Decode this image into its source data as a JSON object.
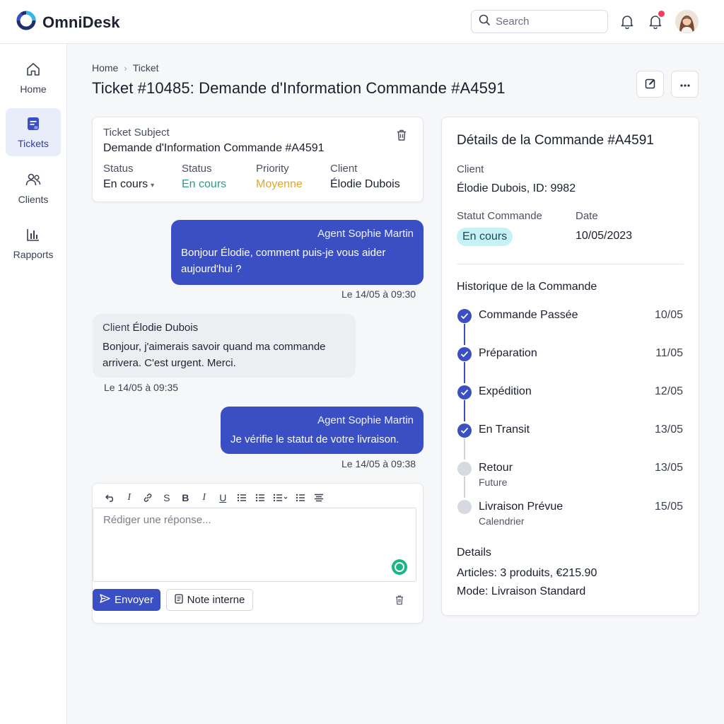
{
  "app": {
    "name": "OmniDesk"
  },
  "search": {
    "placeholder": "Search"
  },
  "colors": {
    "accent": "#3b4fc4",
    "success": "#2f9a83",
    "warning": "#e2a62c",
    "notification": "#ef3f5a",
    "status_pill": "#c6f2f6"
  },
  "sidebar": {
    "items": [
      {
        "label": "Home",
        "icon": "home-icon"
      },
      {
        "label": "Tickets",
        "icon": "tickets-icon",
        "active": true
      },
      {
        "label": "Clients",
        "icon": "users-icon"
      },
      {
        "label": "Rapports",
        "icon": "chart-icon"
      }
    ]
  },
  "breadcrumb": {
    "home": "Home",
    "current": "Ticket"
  },
  "page": {
    "title": "Ticket #10485: Demande d'Information Commande #A4591"
  },
  "ticket": {
    "subject_label": "Ticket Subject",
    "subject": "Demande d'Information Commande #A4591",
    "meta": [
      {
        "label": "Status",
        "value": "En cours"
      },
      {
        "label": "Status",
        "value": "En cours"
      },
      {
        "label": "Priority",
        "value": "Moyenne"
      },
      {
        "label": "Client",
        "value": "Élodie Dubois"
      }
    ]
  },
  "messages": [
    {
      "author": "Agent Sophie Martin",
      "text": "Bonjour Élodie, comment puis-je vous aider aujourd'hui ?",
      "time": "Le 14/05 à 09:30",
      "from": "agent"
    },
    {
      "author_prefix": "Client",
      "author": "Élodie Dubois",
      "text": "Bonjour, j'aimerais savoir quand ma commande arrivera. C'est urgent. Merci.",
      "time": "Le 14/05 à 09:35",
      "from": "client"
    },
    {
      "author": "Agent Sophie Martin",
      "text": "Je vérifie le statut de votre livraison.",
      "time": "Le 14/05 à 09:38",
      "from": "agent"
    }
  ],
  "composer": {
    "placeholder": "Rédiger une réponse...",
    "toolbar": [
      "undo-icon",
      "italic-icon",
      "link-icon",
      "strikethrough-icon",
      "bold-icon",
      "italic-icon",
      "underline-icon",
      "bullet-list-icon",
      "numbered-list-icon",
      "list-dropdown-icon",
      "indent-icon",
      "align-icon"
    ],
    "toolbar_glyphs": {
      "s": "S",
      "b": "B",
      "i": "I",
      "u": "U"
    },
    "send_label": "Envoyer",
    "note_label": "Note interne"
  },
  "order": {
    "title": "Détails de la Commande #A4591",
    "client_label": "Client",
    "client_value": "Élodie Dubois, ID: 9982",
    "status_label": "Statut Commande",
    "status_value": "En cours",
    "date_label": "Date",
    "date_value": "10/05/2023",
    "history_title": "Historique de la Commande",
    "history": [
      {
        "label": "Commande Passée",
        "date": "10/05",
        "done": true
      },
      {
        "label": "Préparation",
        "date": "11/05",
        "done": true
      },
      {
        "label": "Expédition",
        "date": "12/05",
        "done": true
      },
      {
        "label": "En Transit",
        "date": "13/05",
        "done": true
      },
      {
        "label": "Retour",
        "sub": "Future",
        "date": "13/05",
        "done": false
      },
      {
        "label": "Livraison Prévue",
        "sub": "Calendrier",
        "date": "15/05",
        "done": false
      }
    ],
    "details_title": "Details",
    "articles": "Articles: 3 produits, €215.90",
    "mode": "Mode: Livraison Standard"
  }
}
